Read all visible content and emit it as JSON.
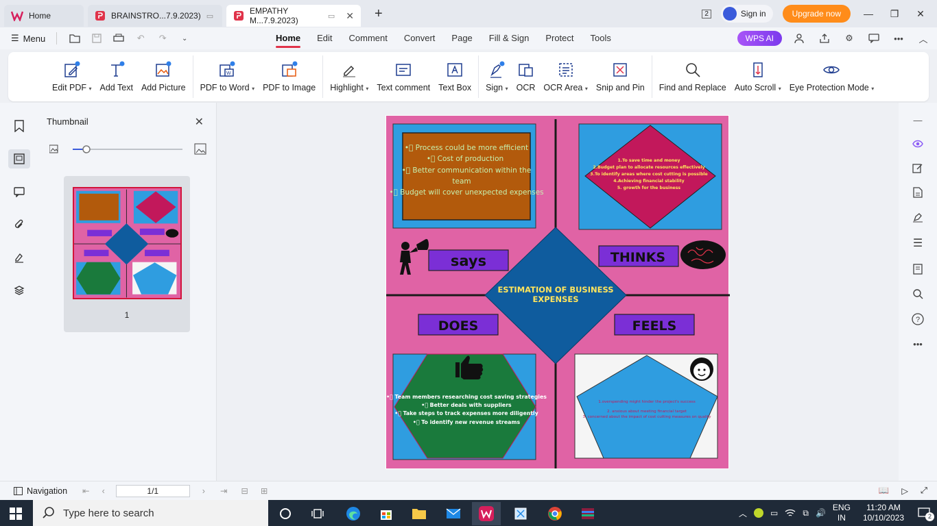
{
  "tabs": [
    {
      "label": "Home"
    },
    {
      "label": "BRAINSTRO...7.9.2023)"
    },
    {
      "label": "EMPATHY M...7.9.2023)"
    }
  ],
  "titlebar": {
    "sign_in": "Sign in",
    "upgrade": "Upgrade now",
    "badge": "2"
  },
  "menubar": {
    "menu_label": "Menu",
    "tabs": [
      "Home",
      "Edit",
      "Comment",
      "Convert",
      "Page",
      "Fill & Sign",
      "Protect",
      "Tools"
    ],
    "wps_ai": "WPS AI"
  },
  "ribbon": [
    {
      "label": "Edit PDF",
      "dropdown": true
    },
    {
      "label": "Add Text",
      "dropdown": false
    },
    {
      "label": "Add Picture",
      "dropdown": false
    },
    {
      "label": "PDF to Word",
      "dropdown": true
    },
    {
      "label": "PDF to Image",
      "dropdown": false
    },
    {
      "label": "Highlight",
      "dropdown": true
    },
    {
      "label": "Text comment",
      "dropdown": false
    },
    {
      "label": "Text Box",
      "dropdown": false
    },
    {
      "label": "Sign",
      "dropdown": true
    },
    {
      "label": "OCR",
      "dropdown": false
    },
    {
      "label": "OCR Area",
      "dropdown": true
    },
    {
      "label": "Snip and Pin",
      "dropdown": false
    },
    {
      "label": "Find and Replace",
      "dropdown": false
    },
    {
      "label": "Auto Scroll",
      "dropdown": true
    },
    {
      "label": "Eye Protection Mode",
      "dropdown": true
    }
  ],
  "thumbnail": {
    "title": "Thumbnail",
    "page_number": "1"
  },
  "document": {
    "center_title": "ESTIMATION OF BUSINESS EXPENSES",
    "labels": {
      "says": "says",
      "thinks": "THINKS",
      "does": "DOES",
      "feels": "FEELS"
    },
    "says_lines": [
      "•\u0000 Process could be more efficient",
      "•\u0000 Cost of production",
      "•\u0000 Better communication within the",
      "team",
      "•\u0000 Budget will cover unexpected expenses"
    ],
    "thinks_lines": [
      "1.To save time and money",
      "2.Budget plan to allocate resources effectively",
      "3.To identify areas where cost cutting is possible",
      "4.Achieving financial stability",
      "5. growth for the business"
    ],
    "does_lines": [
      "•\u0000 Team members researching cost saving strategies",
      "•\u0000 Better deals with suppliers",
      "•\u0000 Take steps to track expenses more diligently",
      "•\u0000 To identify new revenue streams"
    ],
    "feels_lines": [
      "1.overspending might hinder the project's success",
      "2. anxious about meeting financial target",
      "3. concerned about the impact of cost cutting measures on quality"
    ]
  },
  "statusbar": {
    "navigation": "Navigation",
    "page_indicator": "1/1"
  },
  "taskbar": {
    "search_placeholder": "Type here to search",
    "lang_top": "ENG",
    "lang_bottom": "IN",
    "time": "11:20 AM",
    "date": "10/10/2023",
    "notif_count": "2"
  },
  "colors": {
    "accent": "#e0334a",
    "page_pink": "#e063a5",
    "box_blue": "#2f9de0",
    "box_orange": "#b25a0c",
    "diamond_magenta": "#c2185b",
    "center_blue": "#0f5c9e",
    "label_purple": "#7b2fd6",
    "hex_green": "#1a7a3c"
  }
}
